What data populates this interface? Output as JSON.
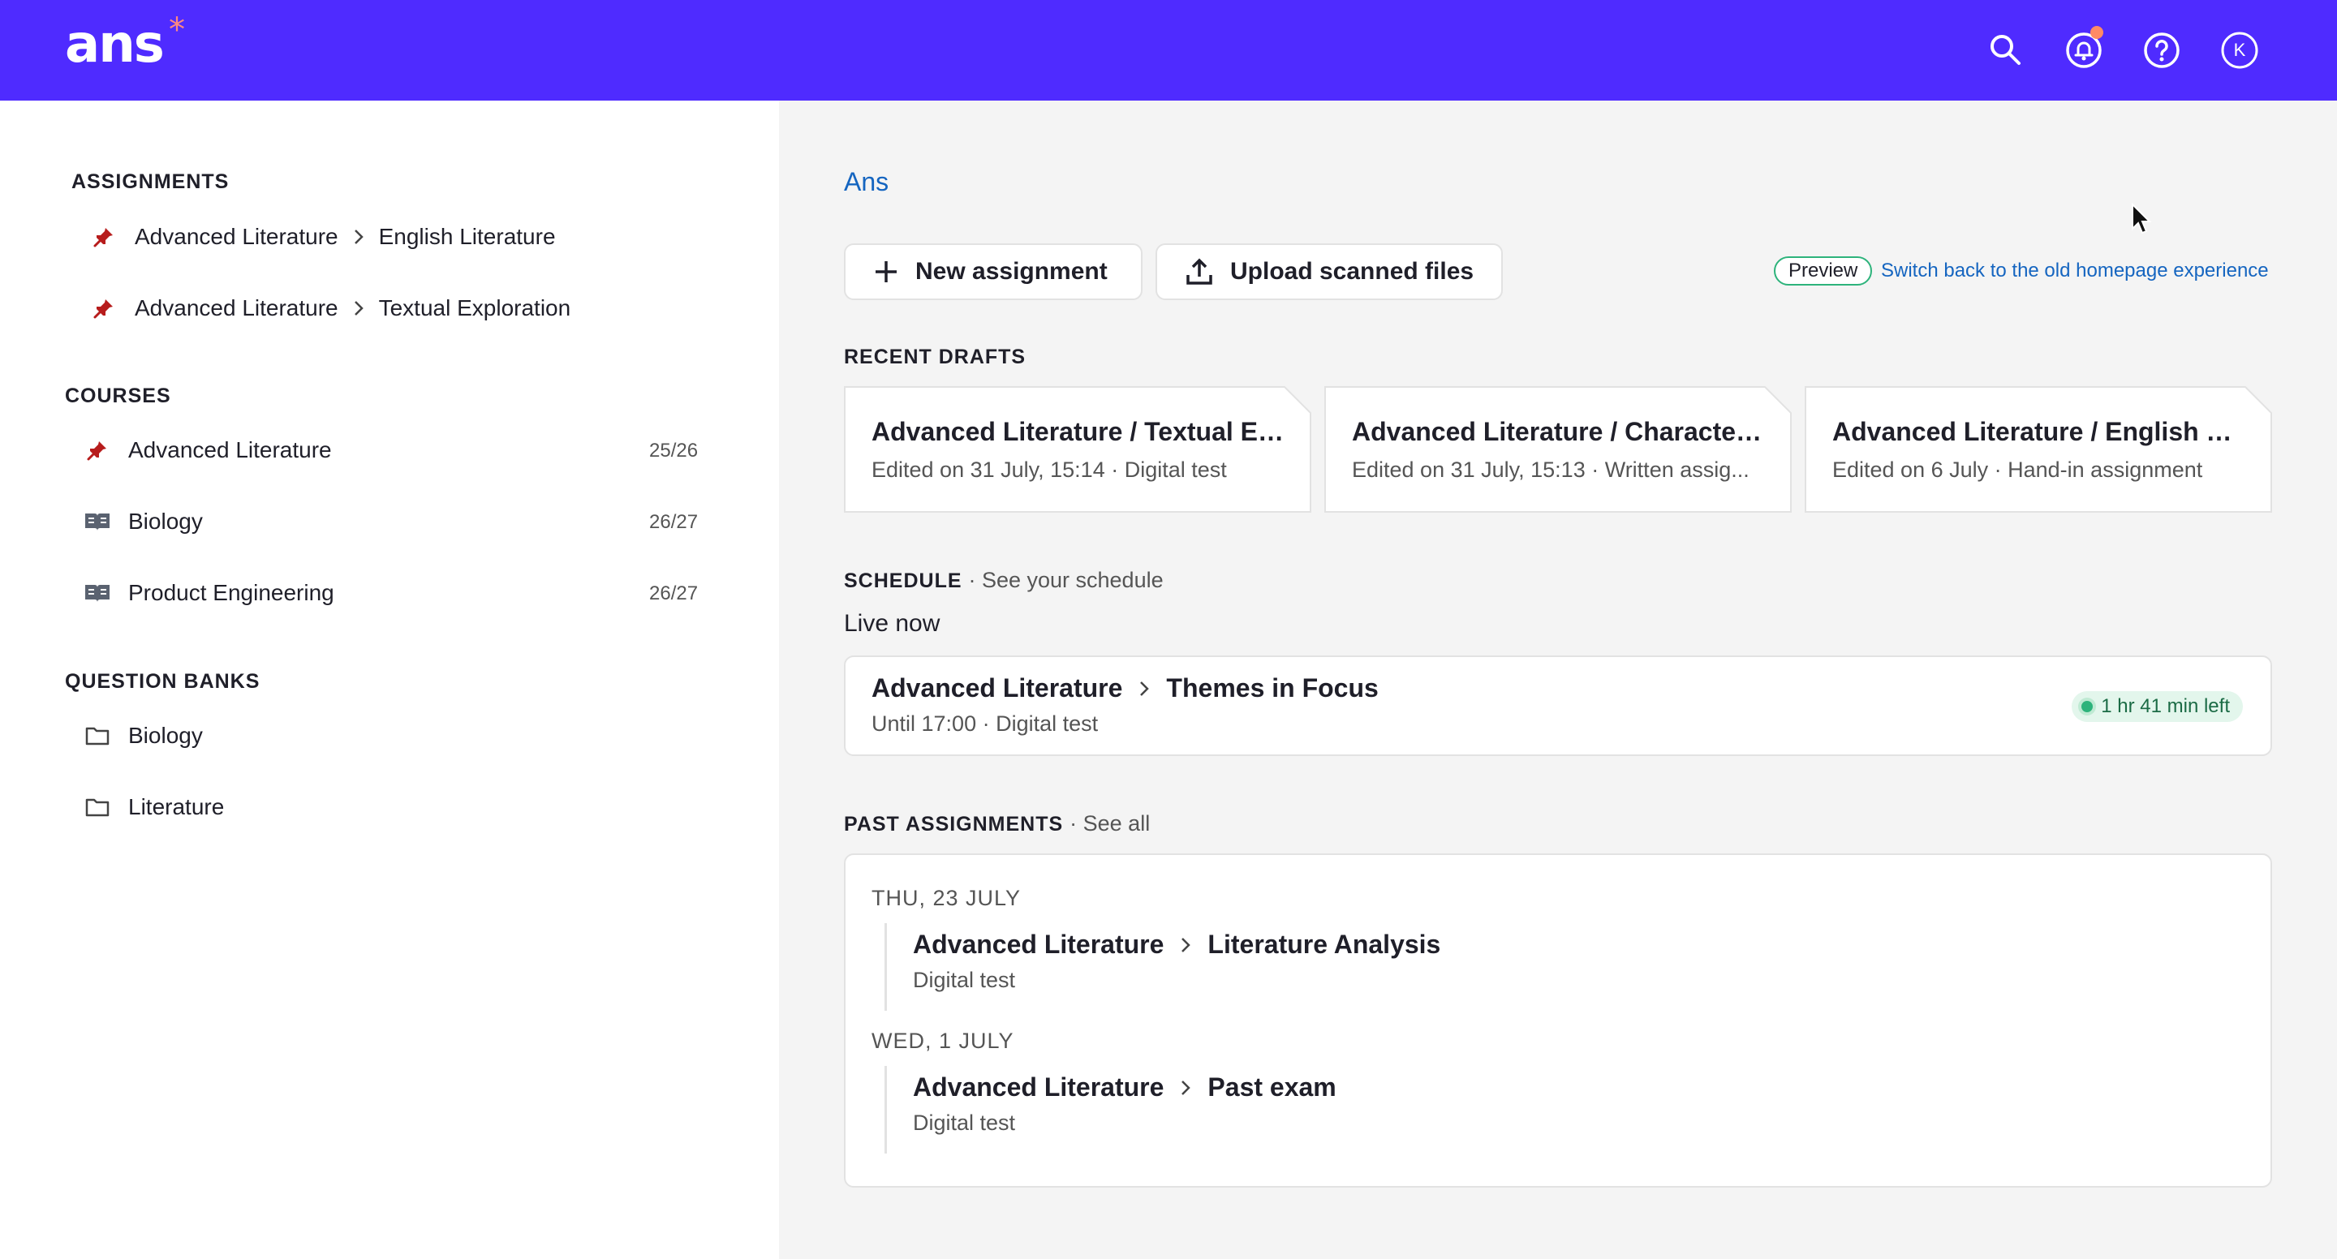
{
  "app": {
    "logo": "ans",
    "logo_mark": "*"
  },
  "header": {
    "icons": [
      "search-icon",
      "notification-bell-icon",
      "help-icon",
      "avatar"
    ],
    "avatar_initial": "K",
    "brand_color": "#4f2bff"
  },
  "sidebar": {
    "assignments_title": "ASSIGNMENTS",
    "assignments": [
      {
        "course": "Advanced Literature",
        "name": "English Literature",
        "icon": "pin-icon"
      },
      {
        "course": "Advanced Literature",
        "name": "Textual Exploration",
        "icon": "pin-icon"
      }
    ],
    "courses_title": "COURSES",
    "courses": [
      {
        "name": "Advanced Literature",
        "count": "25/26",
        "icon": "pin-icon"
      },
      {
        "name": "Biology",
        "count": "26/27",
        "icon": "book-icon"
      },
      {
        "name": "Product Engineering",
        "count": "26/27",
        "icon": "book-icon"
      }
    ],
    "question_banks_title": "QUESTION BANKS",
    "question_banks": [
      {
        "name": "Biology",
        "icon": "folder-icon"
      },
      {
        "name": "Literature",
        "icon": "folder-icon"
      }
    ]
  },
  "main": {
    "breadcrumb": "Ans",
    "new_assignment_label": "New assignment",
    "upload_label": "Upload scanned files",
    "preview_badge": "Preview",
    "switch_link": "Switch back to the old homepage experience",
    "recent_drafts_title": "RECENT DRAFTS",
    "drafts": [
      {
        "title": "Advanced Literature / Textual Ex...",
        "subtitle": "Edited on 31 July, 15:14 · Digital test"
      },
      {
        "title": "Advanced Literature / Character ...",
        "subtitle": "Edited on 31 July, 15:13 · Written assig..."
      },
      {
        "title": "Advanced Literature / English Lit...",
        "subtitle": "Edited on 6 July · Hand-in assignment"
      }
    ],
    "schedule_title": "SCHEDULE",
    "schedule_link": "· See your schedule",
    "live_now_label": "Live now",
    "live": {
      "course": "Advanced Literature",
      "name": "Themes in Focus",
      "subtitle": "Until 17:00 · Digital test",
      "time_left": "1 hr 41 min left"
    },
    "past_title": "PAST ASSIGNMENTS",
    "past_link": "· See all",
    "past_groups": [
      {
        "date": "THU, 23 JULY",
        "course": "Advanced Literature",
        "name": "Literature Analysis",
        "subtitle": "Digital test"
      },
      {
        "date": "WED, 1 JULY",
        "course": "Advanced Literature",
        "name": "Past exam",
        "subtitle": "Digital test"
      }
    ]
  },
  "colors": {
    "accent": "#4f2bff",
    "link": "#1565c0",
    "pin": "#b71c1c",
    "success": "#2db37b"
  }
}
